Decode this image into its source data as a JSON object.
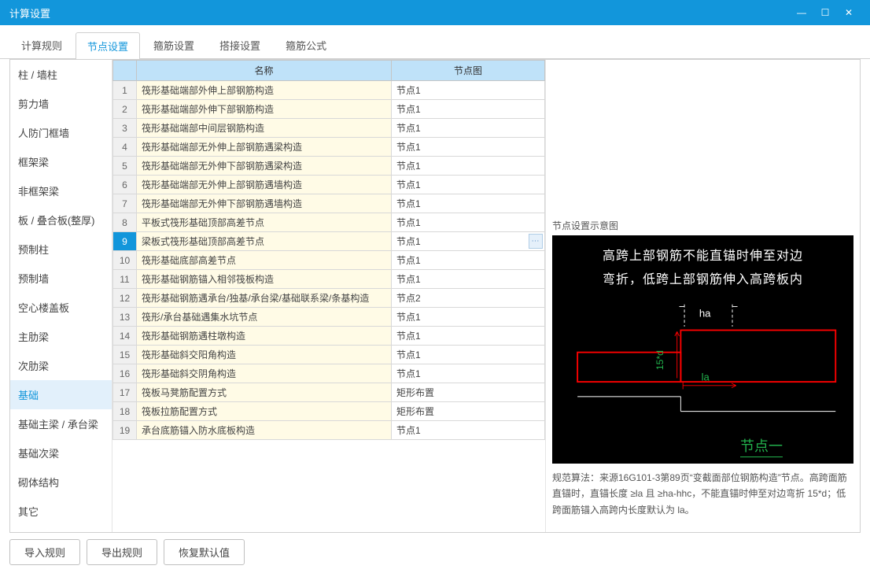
{
  "title": "计算设置",
  "window_buttons": {
    "min": "—",
    "max": "☐",
    "close": "✕"
  },
  "tabs": [
    "计算规则",
    "节点设置",
    "箍筋设置",
    "搭接设置",
    "箍筋公式"
  ],
  "active_tab": 1,
  "sidebar": [
    "柱 / 墙柱",
    "剪力墙",
    "人防门框墙",
    "框架梁",
    "非框架梁",
    "板 / 叠合板(整厚)",
    "预制柱",
    "预制墙",
    "空心楼盖板",
    "主肋梁",
    "次肋梁",
    "基础",
    "基础主梁 / 承台梁",
    "基础次梁",
    "砌体结构",
    "其它"
  ],
  "active_side": 11,
  "table": {
    "headers": [
      "名称",
      "节点图"
    ],
    "rows": [
      {
        "n": "筏形基础端部外伸上部钢筋构造",
        "d": "节点1"
      },
      {
        "n": "筏形基础端部外伸下部钢筋构造",
        "d": "节点1"
      },
      {
        "n": "筏形基础端部中间层钢筋构造",
        "d": "节点1"
      },
      {
        "n": "筏形基础端部无外伸上部钢筋遇梁构造",
        "d": "节点1"
      },
      {
        "n": "筏形基础端部无外伸下部钢筋遇梁构造",
        "d": "节点1"
      },
      {
        "n": "筏形基础端部无外伸上部钢筋遇墙构造",
        "d": "节点1"
      },
      {
        "n": "筏形基础端部无外伸下部钢筋遇墙构造",
        "d": "节点1"
      },
      {
        "n": "平板式筏形基础顶部高差节点",
        "d": "节点1"
      },
      {
        "n": "梁板式筏形基础顶部高差节点",
        "d": "节点1"
      },
      {
        "n": "筏形基础底部高差节点",
        "d": "节点1"
      },
      {
        "n": "筏形基础钢筋锚入相邻筏板构造",
        "d": "节点1"
      },
      {
        "n": "筏形基础钢筋遇承台/独基/承台梁/基础联系梁/条基构造",
        "d": "节点2"
      },
      {
        "n": "筏形/承台基础遇集水坑节点",
        "d": "节点1"
      },
      {
        "n": "筏形基础钢筋遇柱墩构造",
        "d": "节点1"
      },
      {
        "n": "筏形基础斜交阳角构造",
        "d": "节点1"
      },
      {
        "n": "筏形基础斜交阴角构造",
        "d": "节点1"
      },
      {
        "n": "筏板马凳筋配置方式",
        "d": "矩形布置"
      },
      {
        "n": "筏板拉筋配置方式",
        "d": "矩形布置"
      },
      {
        "n": "承台底筋锚入防水底板构造",
        "d": "节点1"
      }
    ],
    "selected": 8
  },
  "preview": {
    "header": "节点设置示意图",
    "line1": "高跨上部钢筋不能直锚时伸至对边",
    "line2": "弯折，低跨上部钢筋伸入高跨板内",
    "label_ha": "ha",
    "label_15d": "15*d",
    "label_la": "la",
    "title": "节点一",
    "note": "规范算法：来源16G101-3第89页“变截面部位钢筋构造”节点。高跨面筋直锚时，直锚长度 ≥la 且 ≥ha-hhc，不能直锚时伸至对边弯折 15*d；低跨面筋锚入高跨内长度默认为 la。"
  },
  "buttons": {
    "import": "导入规则",
    "export": "导出规则",
    "reset": "恢复默认值"
  }
}
